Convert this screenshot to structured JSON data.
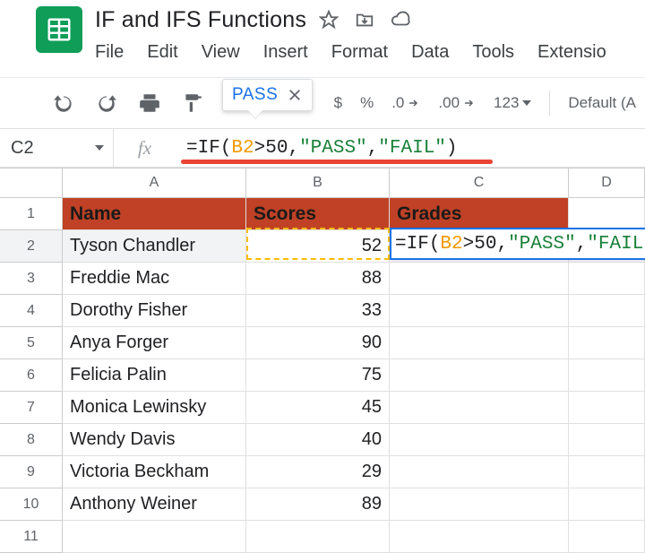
{
  "doc": {
    "title": "IF and IFS Functions"
  },
  "menu": {
    "file": "File",
    "edit": "Edit",
    "view": "View",
    "insert": "Insert",
    "format": "Format",
    "data": "Data",
    "tools": "Tools",
    "extensions": "Extensio"
  },
  "toolbar": {
    "dollar": "$",
    "percent": "%",
    "dec_dec": ".0",
    "inc_dec": ".00",
    "num_fmt": "123",
    "font": "Default (A"
  },
  "tooltip": {
    "text": "PASS"
  },
  "namebox": {
    "ref": "C2"
  },
  "formula_bar": {
    "tokens": [
      {
        "t": "=IF",
        "c": "black"
      },
      {
        "t": "(",
        "c": "black"
      },
      {
        "t": "B2",
        "c": "orange"
      },
      {
        "t": ">50, ",
        "c": "black"
      },
      {
        "t": "\"PASS\"",
        "c": "green"
      },
      {
        "t": ", ",
        "c": "black"
      },
      {
        "t": "\"FAIL\"",
        "c": "green"
      },
      {
        "t": ")",
        "c": "black"
      }
    ]
  },
  "active_cell": {
    "tokens": [
      {
        "t": "=IF",
        "c": "black"
      },
      {
        "t": "(",
        "c": "black"
      },
      {
        "t": "B2",
        "c": "orange"
      },
      {
        "t": ">50, ",
        "c": "black"
      },
      {
        "t": "\"PASS\"",
        "c": "green"
      },
      {
        "t": ", ",
        "c": "black"
      },
      {
        "t": "\"FAIL",
        "c": "green"
      }
    ]
  },
  "columns": {
    "A": "A",
    "B": "B",
    "C": "C",
    "D": "D"
  },
  "headers": {
    "name": "Name",
    "scores": "Scores",
    "grades": "Grades"
  },
  "rows": [
    {
      "n": "1"
    },
    {
      "n": "2",
      "name": "Tyson Chandler",
      "score": "52"
    },
    {
      "n": "3",
      "name": "Freddie Mac",
      "score": "88"
    },
    {
      "n": "4",
      "name": "Dorothy Fisher",
      "score": "33"
    },
    {
      "n": "5",
      "name": "Anya Forger",
      "score": "90"
    },
    {
      "n": "6",
      "name": "Felicia Palin",
      "score": "75"
    },
    {
      "n": "7",
      "name": "Monica Lewinsky",
      "score": "45"
    },
    {
      "n": "8",
      "name": "Wendy Davis",
      "score": "40"
    },
    {
      "n": "9",
      "name": "Victoria Beckham",
      "score": "29"
    },
    {
      "n": "10",
      "name": "Anthony Weiner",
      "score": "89"
    },
    {
      "n": "11"
    }
  ]
}
